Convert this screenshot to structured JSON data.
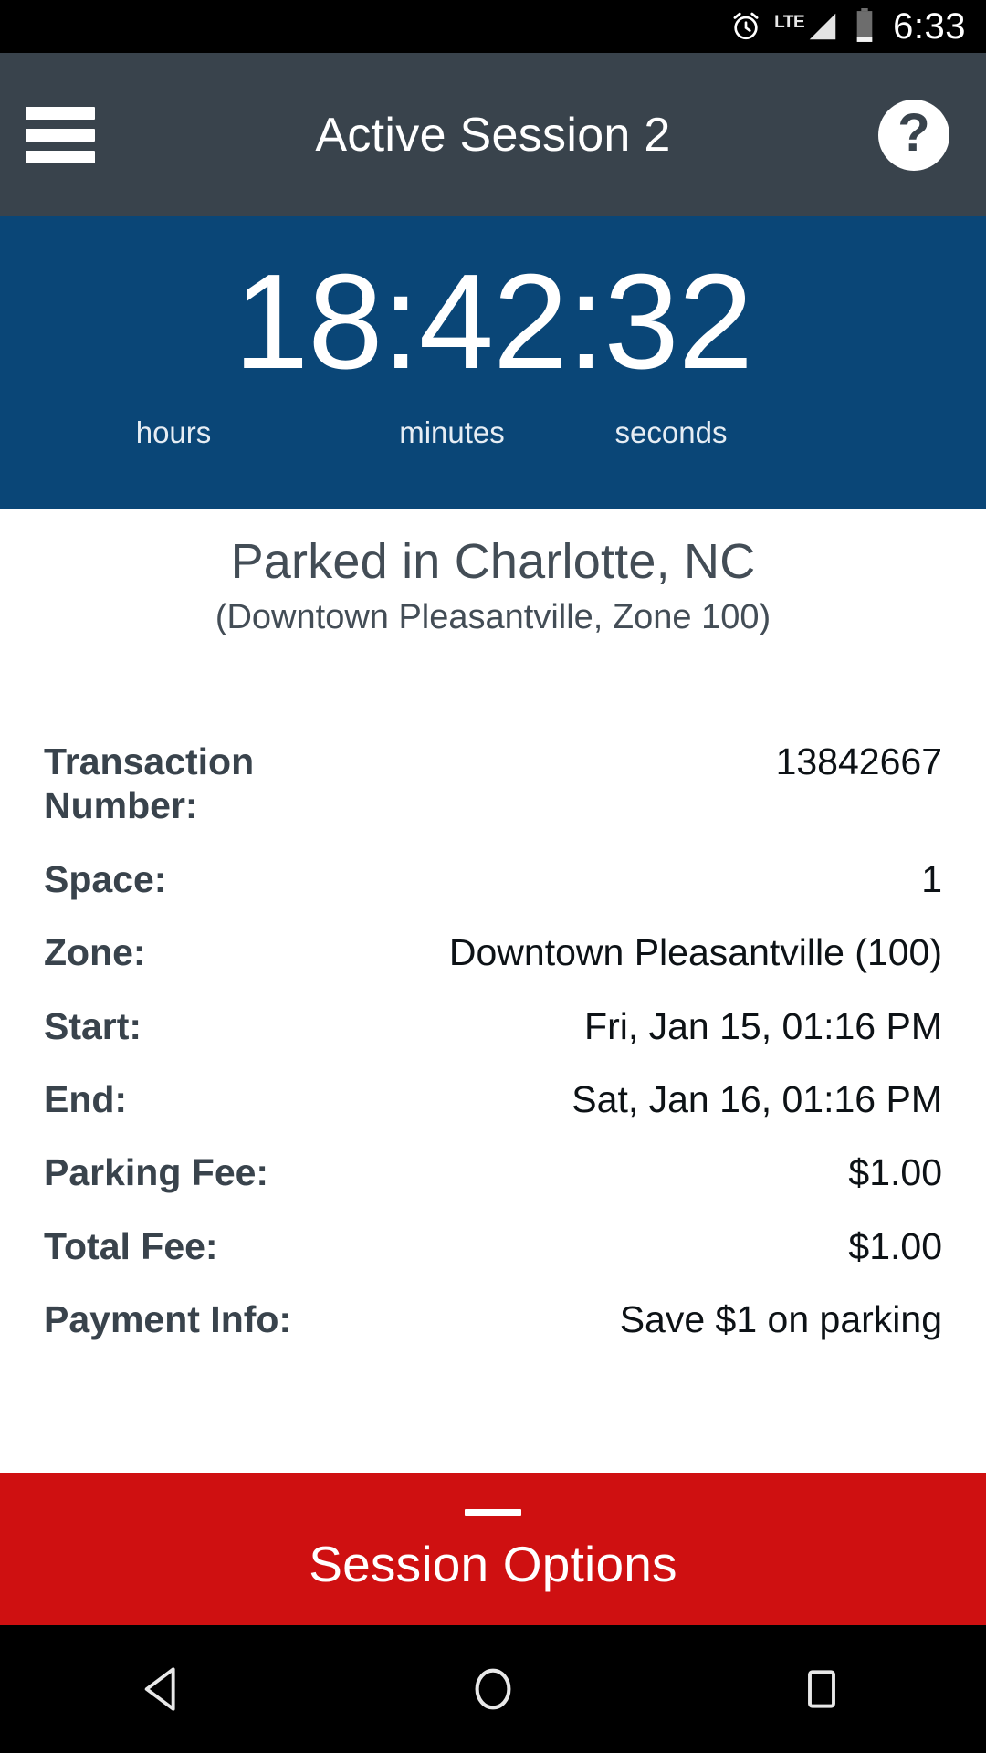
{
  "status_bar": {
    "alarm_icon": "alarm-clock-icon",
    "network_label": "LTE",
    "signal_icon": "signal-bar-icon",
    "battery_icon": "battery-low-icon",
    "time": "6:33"
  },
  "app_bar": {
    "menu_icon": "hamburger-menu-icon",
    "title": "Active Session 2",
    "help_icon": "help-question-icon",
    "help_glyph": "?"
  },
  "timer": {
    "value": "18:42:32",
    "unit_hours": "hours",
    "unit_minutes": "minutes",
    "unit_seconds": "seconds"
  },
  "location": {
    "title": "Parked in Charlotte, NC",
    "subtitle": "(Downtown Pleasantville, Zone 100)"
  },
  "details": [
    {
      "label": "Transaction Number:",
      "value": "13842667"
    },
    {
      "label": "Space:",
      "value": "1"
    },
    {
      "label": "Zone:",
      "value": "Downtown Pleasantville (100)"
    },
    {
      "label": "Start:",
      "value": "Fri, Jan 15, 01:16 PM"
    },
    {
      "label": "End:",
      "value": "Sat, Jan 16, 01:16 PM"
    },
    {
      "label": "Parking Fee:",
      "value": "$1.00"
    },
    {
      "label": "Total Fee:",
      "value": "$1.00"
    },
    {
      "label": "Payment Info:",
      "value": "Save $1 on parking"
    }
  ],
  "session_options": {
    "label": "Session Options",
    "handle_icon": "drag-handle-icon"
  },
  "nav_bar": {
    "back_icon": "back-triangle-icon",
    "home_icon": "home-circle-icon",
    "recents_icon": "recents-square-icon"
  },
  "colors": {
    "status_bar_bg": "#000000",
    "app_bar_bg": "#39434c",
    "timer_bg": "#0a4677",
    "accent_red": "#cf1011",
    "label_text": "#39434c",
    "value_text": "#0d1216",
    "page_bg": "#ffffff"
  }
}
